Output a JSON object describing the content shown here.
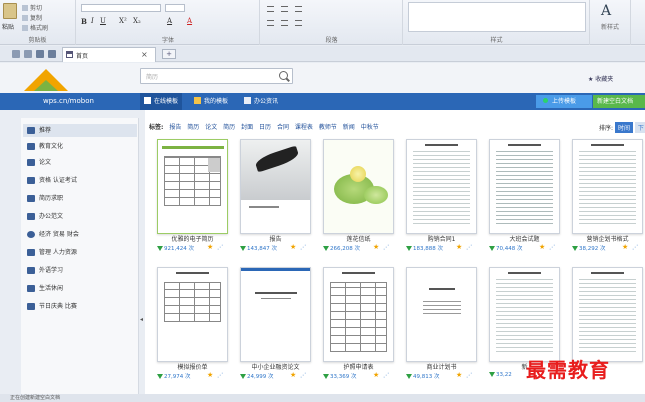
{
  "ribbon": {
    "clipboard": {
      "paste": "粘贴",
      "cut": "剪切",
      "copy": "复制",
      "format_painter": "格式刷",
      "title": "剪贴板"
    },
    "font": {
      "title": "字体"
    },
    "paragraph": {
      "title": "段落"
    },
    "styles": {
      "title": "样式",
      "new_style": "新样式"
    }
  },
  "tabs": {
    "home_label": "首页",
    "close": "×",
    "new_tab": "+"
  },
  "header": {
    "search_placeholder": "简历",
    "favorites": "★ 收藏夹",
    "site": "wps.cn/mobon"
  },
  "nav": {
    "tabs": [
      {
        "label": "在线模板"
      },
      {
        "label": "我的模板"
      },
      {
        "label": "办公资讯"
      }
    ],
    "upload": "上传模板",
    "new_doc": "新建空白文档"
  },
  "sidebar": {
    "items": [
      {
        "label": "推荐"
      },
      {
        "label": "教育文化"
      },
      {
        "label": "论文"
      },
      {
        "label": "资格 认证考试"
      },
      {
        "label": "简历求职"
      },
      {
        "label": "办公范文"
      },
      {
        "label": "经济 贸易 财会"
      },
      {
        "label": "管理 人力资源"
      },
      {
        "label": "外语学习"
      },
      {
        "label": "生活休闲"
      },
      {
        "label": "节日庆典 比赛"
      }
    ]
  },
  "tags": {
    "label": "标签:",
    "items": [
      "报告",
      "简历",
      "论文",
      "简历",
      "封面",
      "日历",
      "合同",
      "课程表",
      "教师节",
      "新闻",
      "中秋节"
    ]
  },
  "sort": {
    "label": "排序:",
    "selected": "时间",
    "other": "下"
  },
  "cards": [
    {
      "title": "优雅的电子简历",
      "count": "921,424 次"
    },
    {
      "title": "报告",
      "count": "143,847 次"
    },
    {
      "title": "莲花信纸",
      "count": "266,208 次"
    },
    {
      "title": "购销合同1",
      "count": "183,888 次"
    },
    {
      "title": "大班会试题",
      "count": "70,448 次"
    },
    {
      "title": "营销企划书格式",
      "count": "38,292 次"
    },
    {
      "title": "模拟报价单",
      "count": "27,974 次"
    },
    {
      "title": "中小企业融资论文",
      "count": "24,999 次"
    },
    {
      "title": "护照申请表",
      "count": "33,369 次"
    },
    {
      "title": "商业计划书",
      "count": "49,813 次"
    },
    {
      "title": "新",
      "count": "33,22"
    }
  ],
  "status": "正在创建新建空白文档",
  "watermark": "最需教育"
}
